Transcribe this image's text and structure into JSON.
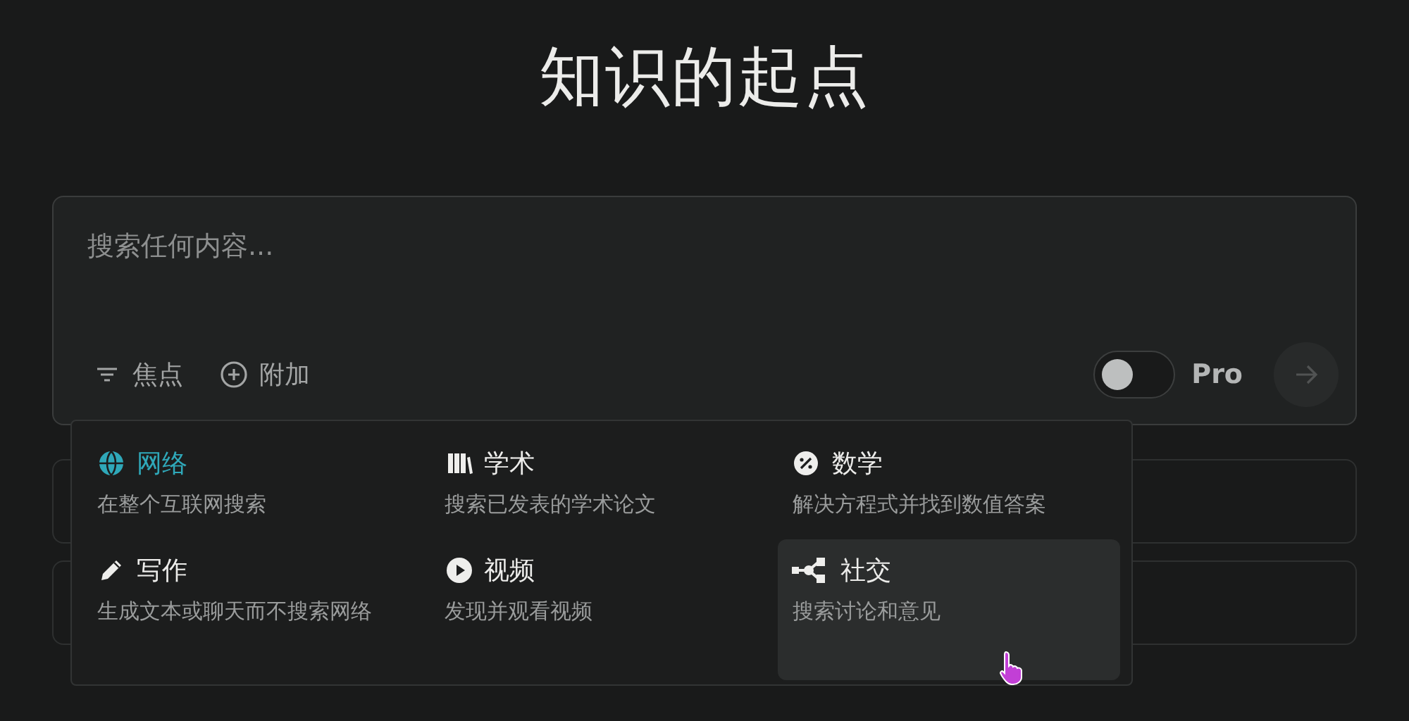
{
  "title": "知识的起点",
  "search": {
    "placeholder": "搜索任何内容...",
    "focus_label": "焦点",
    "attach_label": "附加",
    "pro": {
      "label": "Pro",
      "on": false
    },
    "send_disabled": true
  },
  "focus_menu": {
    "items": [
      {
        "kind": "globe",
        "label": "网络",
        "description": "在整个互联网搜索",
        "selected": true,
        "hovered": false
      },
      {
        "kind": "books",
        "label": "学术",
        "description": "搜索已发表的学术论文",
        "selected": false,
        "hovered": false
      },
      {
        "kind": "math",
        "label": "数学",
        "description": "解决方程式并找到数值答案",
        "selected": false,
        "hovered": false
      },
      {
        "kind": "pencil",
        "label": "写作",
        "description": "生成文本或聊天而不搜索网络",
        "selected": false,
        "hovered": false
      },
      {
        "kind": "play",
        "label": "视频",
        "description": "发现并观看视频",
        "selected": false,
        "hovered": false
      },
      {
        "kind": "network",
        "label": "社交",
        "description": "搜索讨论和意见",
        "selected": false,
        "hovered": true
      }
    ]
  }
}
